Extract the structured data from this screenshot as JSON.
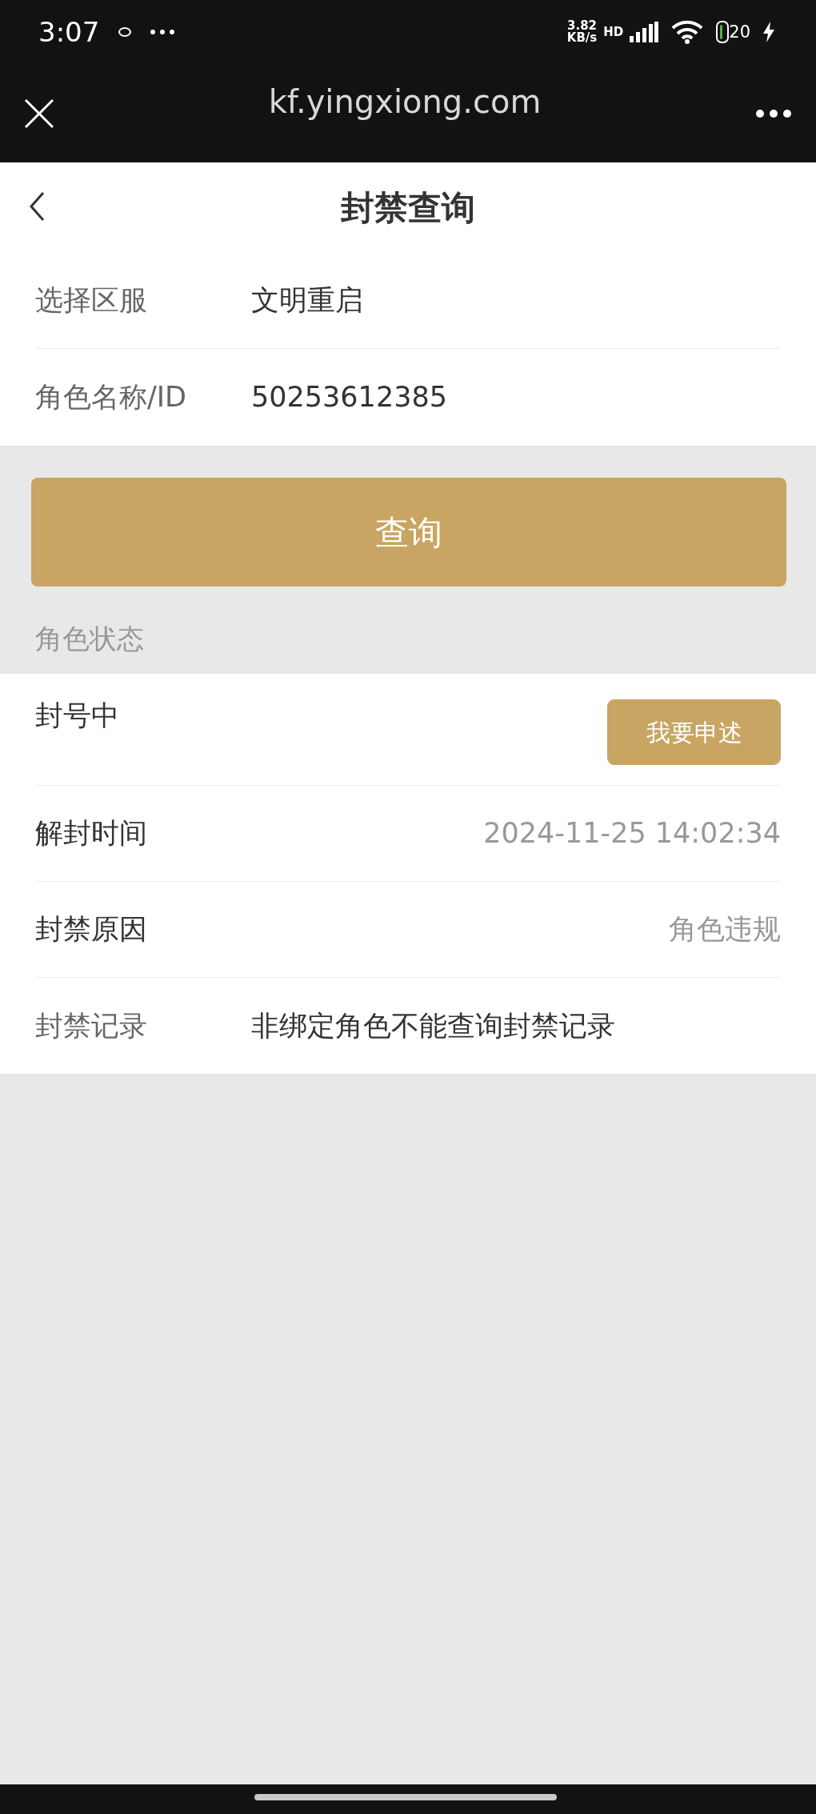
{
  "status_bar": {
    "time": "3:07",
    "net_speed": "3.82",
    "net_unit": "KB/s",
    "network_type": "HD",
    "battery": "20"
  },
  "browser_bar": {
    "url": "kf.yingxiong.com"
  },
  "header": {
    "title": "封禁查询"
  },
  "form": [
    {
      "label": "选择区服",
      "value": "文明重启"
    },
    {
      "label": "角色名称/ID",
      "value": "50253612385"
    }
  ],
  "query_button": "查询",
  "section_title": "角色状态",
  "status_rows": [
    {
      "kind": "action",
      "label": "封号中",
      "button": "我要申述"
    },
    {
      "kind": "value",
      "label": "解封时间",
      "value": "2024-11-25 14:02:34"
    },
    {
      "kind": "value",
      "label": "封禁原因",
      "value": "角色违规"
    },
    {
      "kind": "note",
      "label": "封禁记录",
      "value": "非绑定角色不能查询封禁记录"
    }
  ]
}
